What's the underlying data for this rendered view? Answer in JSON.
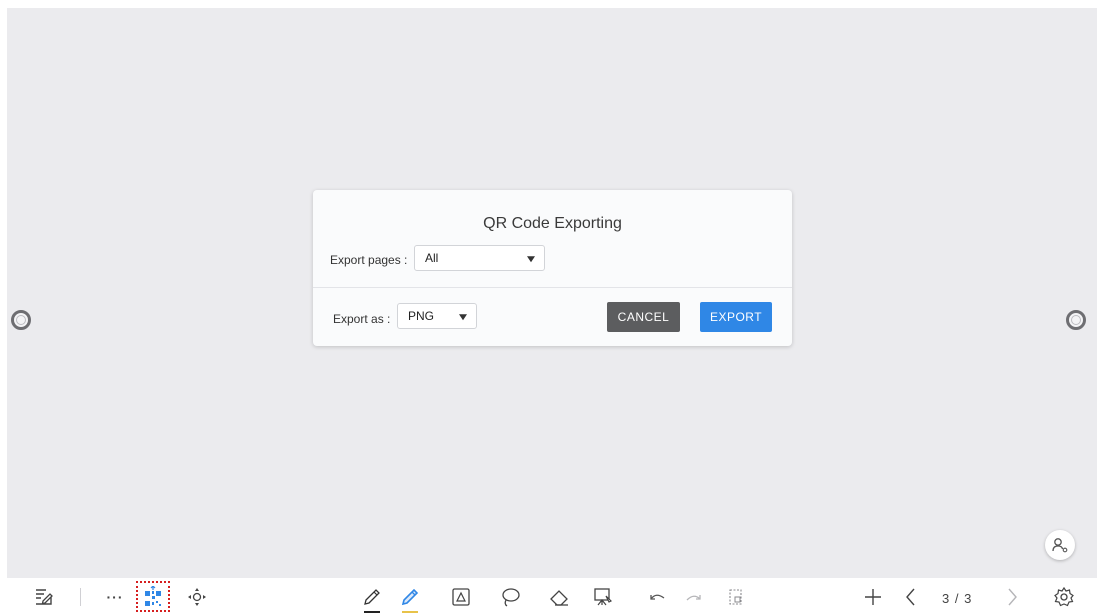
{
  "dialog": {
    "title": "QR Code Exporting",
    "export_pages_label": "Export pages :",
    "export_pages_value": "All",
    "export_as_label": "Export as :",
    "export_as_value": "PNG",
    "cancel_label": "CANCEL",
    "export_label": "EXPORT"
  },
  "toolbar": {
    "page_indicator": "3 / 3",
    "more_label": "···"
  },
  "colors": {
    "canvas": "#ebebee",
    "export_button": "#2f87e6",
    "cancel_button": "#5c5d5f",
    "qr_highlight_border": "#d61f1f",
    "active_tool": "#2f87e6"
  },
  "icons": [
    "note-menu-icon",
    "more-icon",
    "qr-code-icon",
    "move-icon",
    "pen-icon",
    "highlighter-icon",
    "shape-recognition-icon",
    "lasso-icon",
    "eraser-icon",
    "present-icon",
    "undo-icon",
    "redo-icon",
    "page-preview-icon",
    "add-page-icon",
    "prev-page-icon",
    "next-page-icon",
    "settings-icon",
    "user-icon"
  ]
}
